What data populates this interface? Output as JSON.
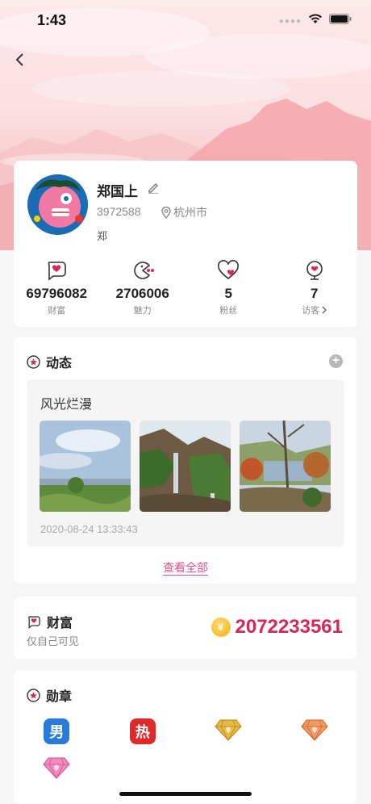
{
  "status": {
    "time": "1:43"
  },
  "profile": {
    "name": "郑国上",
    "id": "3972588",
    "location": "杭州市",
    "signature": "郑",
    "stats": [
      {
        "icon": "wealth-icon",
        "value": "69796082",
        "label": "财富"
      },
      {
        "icon": "charm-icon",
        "value": "2706006",
        "label": "魅力"
      },
      {
        "icon": "fans-icon",
        "value": "5",
        "label": "粉丝"
      },
      {
        "icon": "visitor-icon",
        "value": "7",
        "label": "访客"
      }
    ]
  },
  "dynamics": {
    "title": "动态",
    "post": {
      "title": "风光烂漫",
      "time": "2020-08-24 13:33:43"
    },
    "view_all": "查看全部"
  },
  "wealth": {
    "title": "财富",
    "subtitle": "仅自己可见",
    "coin_symbol": "¥",
    "value": "2072233561"
  },
  "medals": {
    "title": "勋章",
    "items": [
      {
        "icon": "male-badge-icon",
        "text": "男"
      },
      {
        "icon": "hot-badge-icon",
        "text": "热"
      },
      {
        "icon": "gold-diamond-icon",
        "text": ""
      },
      {
        "icon": "orange-diamond-icon",
        "text": ""
      },
      {
        "icon": "pink-diamond-icon",
        "text": ""
      }
    ]
  },
  "colors": {
    "accent": "#d4285b",
    "link": "#e0508a"
  }
}
